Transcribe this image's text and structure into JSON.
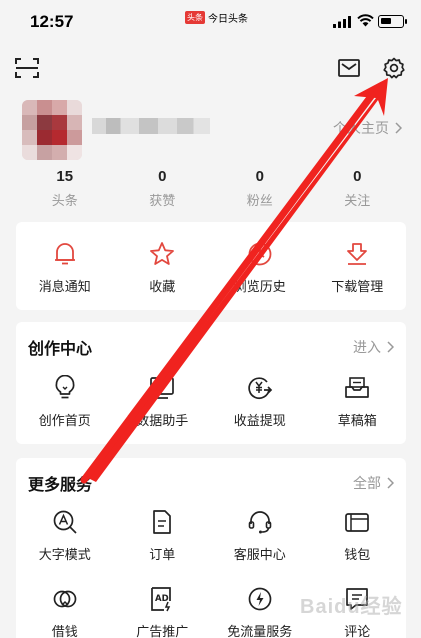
{
  "status": {
    "time": "12:57",
    "app_badge": "头条",
    "app_name": "今日头条",
    "battery_level": 0.55
  },
  "profile": {
    "home_link": "个人主页"
  },
  "stats": [
    {
      "value": "15",
      "label": "头条"
    },
    {
      "value": "0",
      "label": "获赞"
    },
    {
      "value": "0",
      "label": "粉丝"
    },
    {
      "value": "0",
      "label": "关注"
    }
  ],
  "quick_actions": [
    {
      "label": "消息通知",
      "icon": "bell-icon"
    },
    {
      "label": "收藏",
      "icon": "star-icon"
    },
    {
      "label": "浏览历史",
      "icon": "clock-icon"
    },
    {
      "label": "下载管理",
      "icon": "download-icon"
    }
  ],
  "creator": {
    "title": "创作中心",
    "more": "进入",
    "items": [
      {
        "label": "创作首页",
        "icon": "lightbulb-icon"
      },
      {
        "label": "数据助手",
        "icon": "chart-icon"
      },
      {
        "label": "收益提现",
        "icon": "yuan-exchange-icon"
      },
      {
        "label": "草稿箱",
        "icon": "draft-box-icon"
      }
    ]
  },
  "services": {
    "title": "更多服务",
    "more": "全部",
    "items": [
      {
        "label": "大字模式",
        "icon": "large-font-icon"
      },
      {
        "label": "订单",
        "icon": "order-icon"
      },
      {
        "label": "客服中心",
        "icon": "headset-icon"
      },
      {
        "label": "钱包",
        "icon": "wallet-icon"
      },
      {
        "label": "借钱",
        "icon": "borrow-icon"
      },
      {
        "label": "广告推广",
        "icon": "ad-icon"
      },
      {
        "label": "免流量服务",
        "icon": "data-free-icon"
      },
      {
        "label": "评论",
        "icon": "comment-icon"
      }
    ]
  },
  "colors": {
    "accent": "#e2483f",
    "annotation_arrow": "#f0231f"
  },
  "watermark": "Baidu经验"
}
